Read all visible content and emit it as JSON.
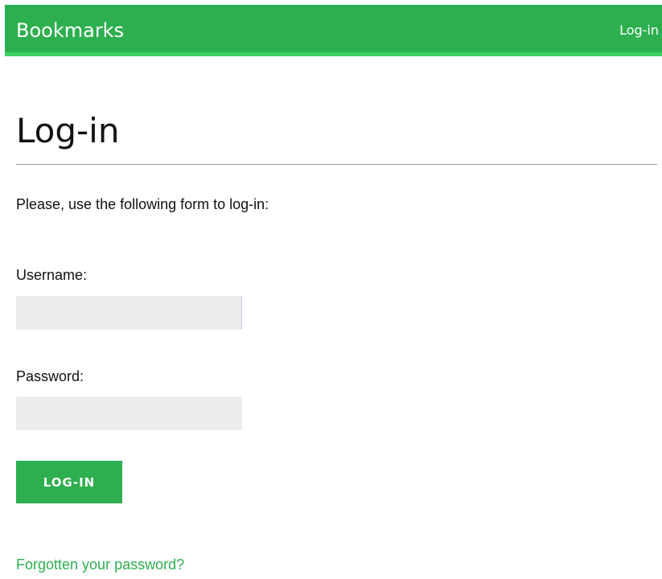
{
  "header": {
    "logo": "Bookmarks",
    "nav_login": "Log-in",
    "bg_color": "#2daf4f",
    "accent_color": "#3fd160"
  },
  "main": {
    "title": "Log-in",
    "intro": "Please, use the following form to log-in:",
    "form": {
      "username_label": "Username:",
      "username_value": "",
      "password_label": "Password:",
      "password_value": "",
      "submit_label": "LOG-IN"
    },
    "forgot_link": "Forgotten your password?"
  }
}
